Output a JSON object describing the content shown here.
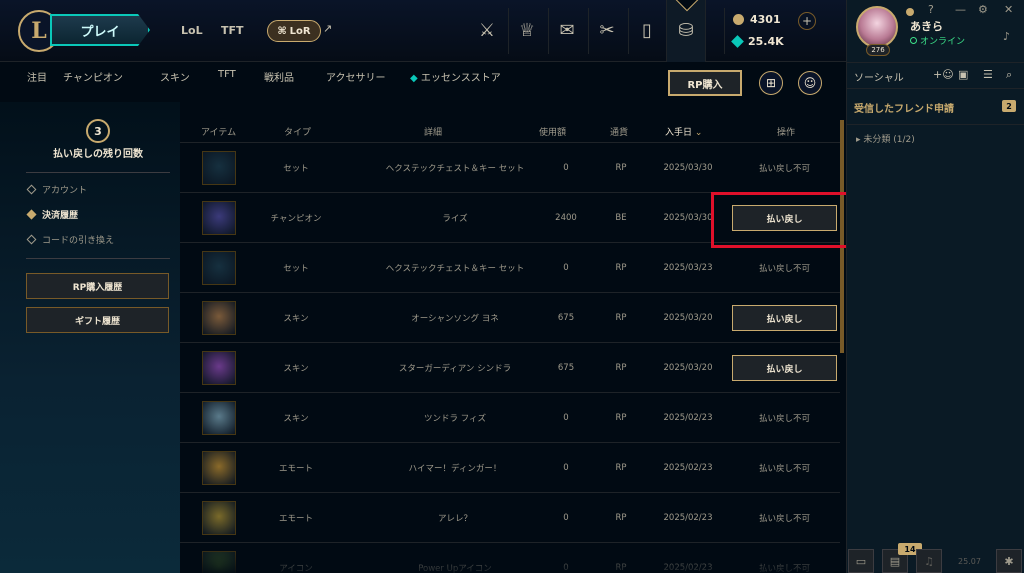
{
  "topbar": {
    "logo": "L",
    "play": "プレイ",
    "games": [
      "LoL",
      "TFT"
    ],
    "lor": "LoR",
    "external_icon": "external-link-icon",
    "nav_icons": [
      "clash-icon",
      "ranked-icon",
      "collection-icon",
      "loot-icon",
      "loadout-icon",
      "store-icon"
    ],
    "rp": "4301",
    "be": "25.4K",
    "plus": "+"
  },
  "subnav": {
    "items": [
      "注目",
      "チャンピオン",
      "スキン",
      "TFT",
      "戦利品",
      "アクセサリー",
      "エッセンスストア"
    ],
    "rp_buy": "RP購入",
    "gift_icon": "gift-icon",
    "account_icon": "account-icon"
  },
  "left": {
    "refund_count": "3",
    "refund_label": "払い戻しの残り回数",
    "items": [
      "アカウント",
      "決済履歴",
      "コードの引き換え"
    ],
    "active_index": 1,
    "rp_history": "RP購入履歴",
    "gift_history": "ギフト履歴"
  },
  "table": {
    "headers": {
      "item": "アイテム",
      "type": "タイプ",
      "detail": "詳細",
      "amount": "使用額",
      "currency": "通貨",
      "date": "入手日",
      "sort_icon": "chevron-down-icon",
      "action": "操作"
    },
    "rows": [
      {
        "type": "セット",
        "detail": "ヘクステックチェスト＆キー セット",
        "amount": "0",
        "currency": "RP",
        "date": "2025/03/30",
        "action": "払い戻し不可",
        "refundable": false,
        "thumb": "#16303f"
      },
      {
        "type": "チャンピオン",
        "detail": "ライズ",
        "amount": "2400",
        "currency": "BE",
        "date": "2025/03/30",
        "action": "払い戻し",
        "refundable": true,
        "thumb": "#3b3a7a"
      },
      {
        "type": "セット",
        "detail": "ヘクステックチェスト＆キー セット",
        "amount": "0",
        "currency": "RP",
        "date": "2025/03/23",
        "action": "払い戻し不可",
        "refundable": false,
        "thumb": "#16303f"
      },
      {
        "type": "スキン",
        "detail": "オーシャンソング ヨネ",
        "amount": "675",
        "currency": "RP",
        "date": "2025/03/20",
        "action": "払い戻し",
        "refundable": true,
        "thumb": "#7a5a3a"
      },
      {
        "type": "スキン",
        "detail": "スターガーディアン シンドラ",
        "amount": "675",
        "currency": "RP",
        "date": "2025/03/20",
        "action": "払い戻し",
        "refundable": true,
        "thumb": "#6a3a8a"
      },
      {
        "type": "スキン",
        "detail": "ツンドラ フィズ",
        "amount": "0",
        "currency": "RP",
        "date": "2025/02/23",
        "action": "払い戻し不可",
        "refundable": false,
        "thumb": "#5a7a8a"
      },
      {
        "type": "エモート",
        "detail": "ハイマー！ディンガー！",
        "amount": "0",
        "currency": "RP",
        "date": "2025/02/23",
        "action": "払い戻し不可",
        "refundable": false,
        "thumb": "#8a6a2a"
      },
      {
        "type": "エモート",
        "detail": "アレレ？",
        "amount": "0",
        "currency": "RP",
        "date": "2025/02/23",
        "action": "払い戻し不可",
        "refundable": false,
        "thumb": "#7a6a2a"
      },
      {
        "type": "アイコン",
        "detail": "Power Upアイコン",
        "amount": "0",
        "currency": "RP",
        "date": "2025/02/23",
        "action": "払い戻し不可",
        "refundable": false,
        "thumb": "#3a5a2a"
      }
    ]
  },
  "social": {
    "username": "あきら",
    "status": "オンライン",
    "level": "276",
    "help_icon": "help-icon",
    "minimize_icon": "minimize-icon",
    "settings_icon": "gear-icon",
    "close_icon": "close-icon",
    "title": "ソーシャル",
    "friend_requests": "受信したフレンド申請",
    "request_count": "2",
    "group": "未分類 (1/2)",
    "notification_count": "14",
    "version": "25.07"
  }
}
